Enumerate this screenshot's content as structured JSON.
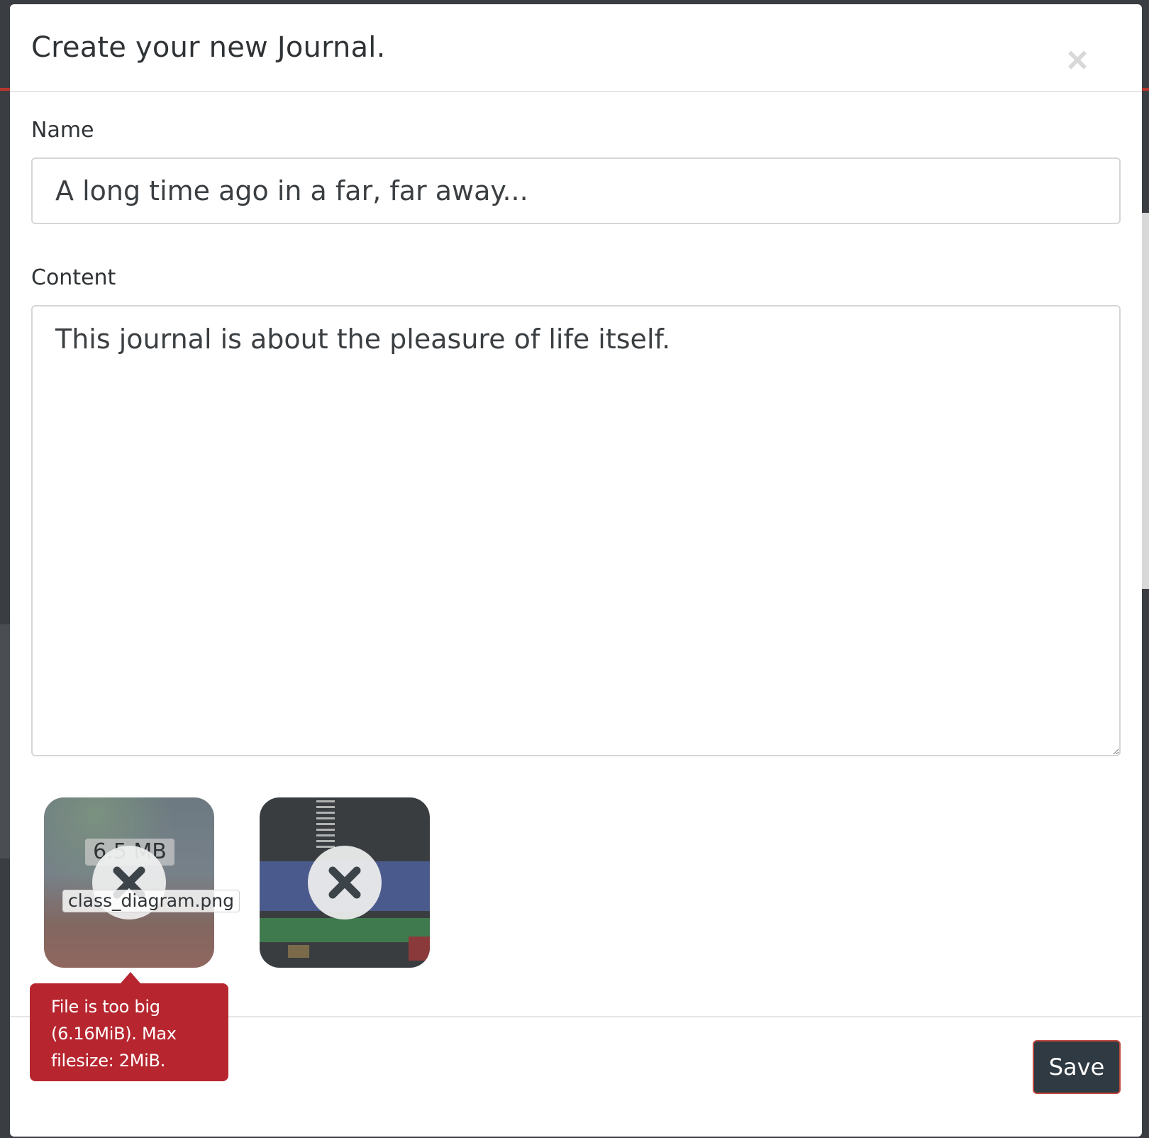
{
  "modal": {
    "title": "Create your new Journal.",
    "close_symbol": "×"
  },
  "form": {
    "name_label": "Name",
    "name_value": "A long time ago in a far, far away...",
    "content_label": "Content",
    "content_value": "This journal is about the pleasure of life itself."
  },
  "uploads": [
    {
      "file_size": "6.5 MB",
      "file_name": "class_diagram.png",
      "error": "File is too big (6.16MiB). Max filesize: 2MiB.",
      "icon": "remove-icon"
    },
    {
      "icon": "remove-icon"
    }
  ],
  "footer": {
    "save_label": "Save"
  },
  "colors": {
    "error": "#b7262f",
    "save_bg": "#2f3a42",
    "save_border": "#c14a3d"
  }
}
